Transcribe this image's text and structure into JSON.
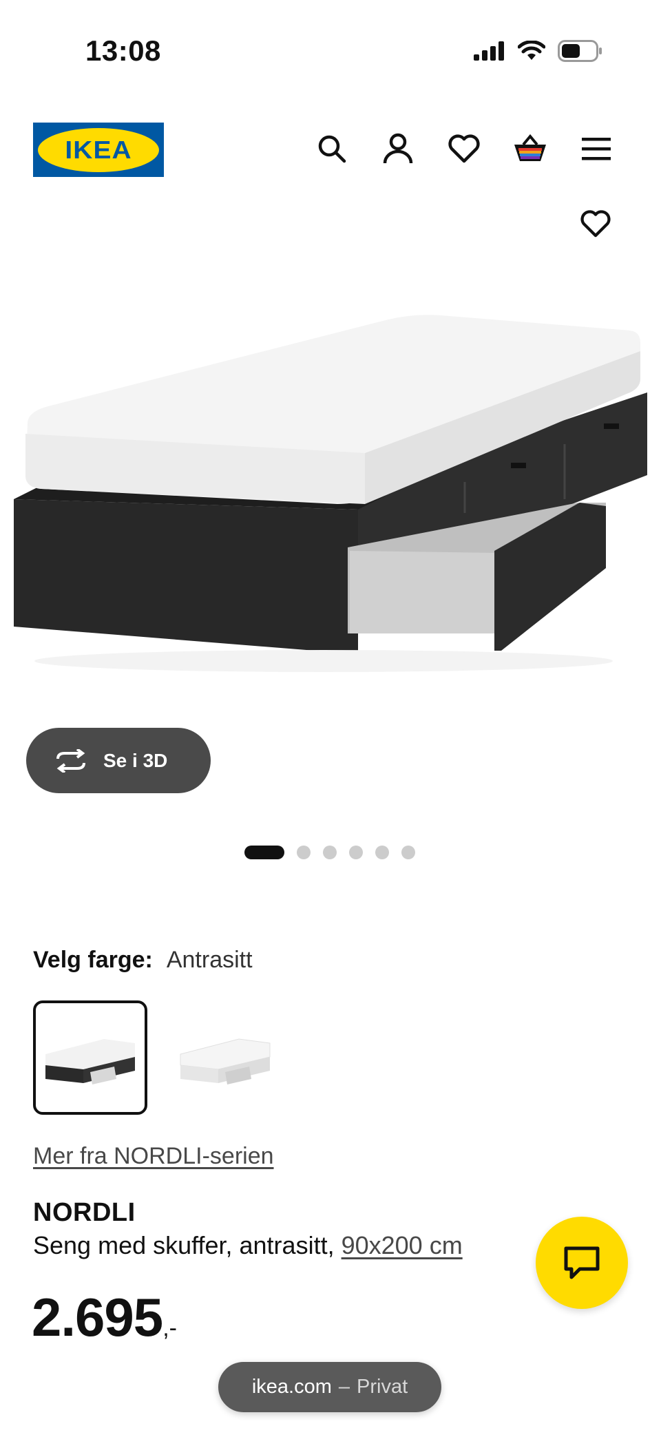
{
  "status_bar": {
    "time": "13:08"
  },
  "header": {
    "logo_text": "IKEA"
  },
  "product_gallery": {
    "button_3d_label": "Se i 3D",
    "image_count": 6,
    "active_index": 0
  },
  "color_selection": {
    "label": "Velg farge:",
    "selected_value": "Antrasitt",
    "options": [
      "anthracite",
      "white"
    ]
  },
  "series_link": "Mer fra NORDLI-serien",
  "product": {
    "name": "NORDLI",
    "description": "Seng med skuffer, antrasitt, ",
    "size": "90x200 cm",
    "price": "2.695",
    "price_suffix": ",-"
  },
  "browser": {
    "domain": "ikea.com",
    "separator": "–",
    "mode": "Privat"
  },
  "colors": {
    "ikea_blue": "#0058a3",
    "ikea_yellow": "#ffdb00",
    "button_dark": "#4a4a4a"
  },
  "icons": [
    "search-icon",
    "account-icon",
    "favourites-icon",
    "basket-icon",
    "menu-icon",
    "heart-icon",
    "rotate-3d-icon",
    "chat-icon"
  ]
}
